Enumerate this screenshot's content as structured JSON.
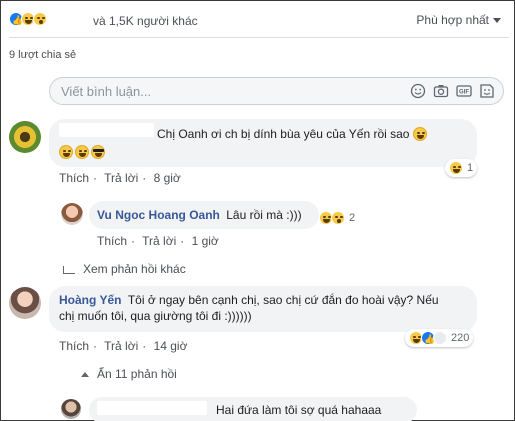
{
  "header": {
    "others_text": "và 1,5K người khác",
    "sort_label": "Phù hợp nhất"
  },
  "shares": "9 lượt chia sẻ",
  "comment_input": {
    "placeholder": "Viết bình luận..."
  },
  "input_icons": [
    "emoji-icon",
    "camera-icon",
    "gif-icon",
    "sticker-icon"
  ],
  "comments": [
    {
      "text_line1": "Chị Oanh ơi ch bị dính bùa yêu của Yến rồi sao",
      "actions": {
        "like": "Thích",
        "reply": "Trả lời",
        "time": "8 giờ"
      },
      "reaction_count": "1"
    },
    {
      "author": "Vu Ngoc Hoang Oanh",
      "text": "Lâu rồi mà :)))",
      "actions": {
        "like": "Thích",
        "reply": "Trả lời",
        "time": "1 giờ"
      },
      "reaction_count": "2"
    },
    {
      "author": "Hoàng Yến",
      "text_line1": "Tôi ở ngay bên cạnh chị, sao chị cứ đắn đo hoài vậy? Nếu",
      "text_line2": "chị muốn tôi, qua giường tôi đi :))))))",
      "actions": {
        "like": "Thích",
        "reply": "Trả lời",
        "time": "14 giờ"
      },
      "reaction_count": "220"
    },
    {
      "text": "Hai đứa làm tôi sợ quá hahaaa"
    }
  ],
  "more_replies": "Xem phản hồi khác",
  "hide_replies": "Ẩn 11 phản hồi",
  "colors": {
    "link": "#385898",
    "like_blue": "#1877f2",
    "bubble": "#f2f3f5"
  }
}
